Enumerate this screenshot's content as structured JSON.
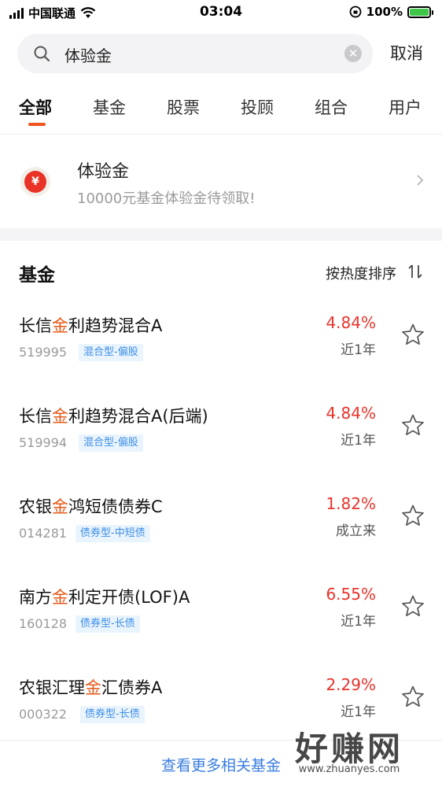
{
  "status_bar": {
    "carrier": "中国联通",
    "time": "03:04",
    "battery": "100%"
  },
  "search": {
    "query": "体验金",
    "cancel_label": "取消"
  },
  "tabs": [
    {
      "label": "全部",
      "active": true
    },
    {
      "label": "基金",
      "active": false
    },
    {
      "label": "股票",
      "active": false
    },
    {
      "label": "投顾",
      "active": false
    },
    {
      "label": "组合",
      "active": false
    },
    {
      "label": "用户",
      "active": false
    }
  ],
  "promo": {
    "icon_glyph": "¥",
    "title": "体验金",
    "subtitle": "10000元基金体验金待领取!"
  },
  "fund_section": {
    "title": "基金",
    "sort_label": "按热度排序"
  },
  "funds": [
    {
      "name_pre": "长信",
      "name_hl": "金",
      "name_post": "利趋势混合A",
      "code": "519995",
      "tag": "混合型-偏股",
      "return": "4.84%",
      "period": "近1年"
    },
    {
      "name_pre": "长信",
      "name_hl": "金",
      "name_post": "利趋势混合A(后端)",
      "code": "519994",
      "tag": "混合型-偏股",
      "return": "4.84%",
      "period": "近1年"
    },
    {
      "name_pre": "农银",
      "name_hl": "金",
      "name_post": "鸿短债债券C",
      "code": "014281",
      "tag": "债券型-中短债",
      "return": "1.82%",
      "period": "成立来"
    },
    {
      "name_pre": "南方",
      "name_hl": "金",
      "name_post": "利定开债(LOF)A",
      "code": "160128",
      "tag": "债券型-长债",
      "return": "6.55%",
      "period": "近1年"
    },
    {
      "name_pre": "农银汇理",
      "name_hl": "金",
      "name_post": "汇债券A",
      "code": "000322",
      "tag": "债券型-长债",
      "return": "2.29%",
      "period": "近1年"
    }
  ],
  "more_link": "查看更多相关基金",
  "watermark": {
    "big": "好赚网",
    "small": "www.zhuanyes.com"
  },
  "colors": {
    "accent": "#f0541e",
    "positive_return": "#e8322a",
    "tag_text": "#3c8ee6",
    "link": "#3a7ee0"
  }
}
